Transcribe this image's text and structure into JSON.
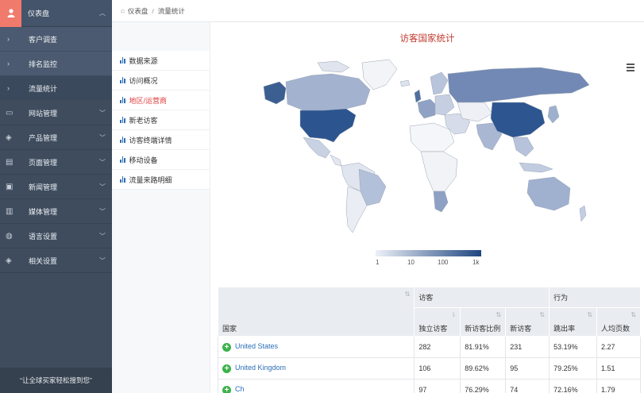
{
  "sidebar": {
    "top": {
      "label": "仪表盘"
    },
    "subs": [
      {
        "label": "客户调查"
      },
      {
        "label": "排名监控"
      },
      {
        "label": "流量统计"
      }
    ],
    "menus": [
      {
        "label": "网站管理"
      },
      {
        "label": "产品管理"
      },
      {
        "label": "页面管理"
      },
      {
        "label": "新闻管理"
      },
      {
        "label": "媒体管理"
      },
      {
        "label": "语言设置"
      },
      {
        "label": "相关设置"
      }
    ],
    "footer": "“让全球买家轻松搜到您”"
  },
  "breadcrumb": {
    "home": "仪表盘",
    "separator": "/",
    "current": "流量统计"
  },
  "subnav": [
    {
      "label": "数据来源"
    },
    {
      "label": "访问概况"
    },
    {
      "label": "地区/运营商"
    },
    {
      "label": "新老访客"
    },
    {
      "label": "访客终端详情"
    },
    {
      "label": "移动设备"
    },
    {
      "label": "流量来路明细"
    }
  ],
  "map": {
    "title": "访客国家统计",
    "legend_ticks": [
      "1",
      "10",
      "100",
      "1k"
    ],
    "color_low": "#edf0f8",
    "color_high": "#1f467f"
  },
  "table": {
    "group_headers": {
      "visitors": "访客",
      "behavior": "行为"
    },
    "columns": {
      "country": "国家",
      "unique": "独立访客",
      "new_ratio": "新访客比例",
      "new": "新访客",
      "bounce": "跳出率",
      "pages": "人均页数"
    },
    "rows": [
      {
        "country": "United States",
        "unique": "282",
        "new_ratio": "81.91%",
        "new": "231",
        "bounce": "53.19%",
        "pages": "2.27"
      },
      {
        "country": "United Kingdom",
        "unique": "106",
        "new_ratio": "89.62%",
        "new": "95",
        "bounce": "79.25%",
        "pages": "1.51"
      },
      {
        "country": "Ch",
        "unique": "97",
        "new_ratio": "76.29%",
        "new": "74",
        "bounce": "72.16%",
        "pages": "1.79"
      }
    ]
  },
  "colors": {
    "accent_red": "#e0413e",
    "sidebar_bg": "#3e4c5e",
    "link_blue": "#2a6fb8",
    "plus_green": "#3db24b"
  }
}
